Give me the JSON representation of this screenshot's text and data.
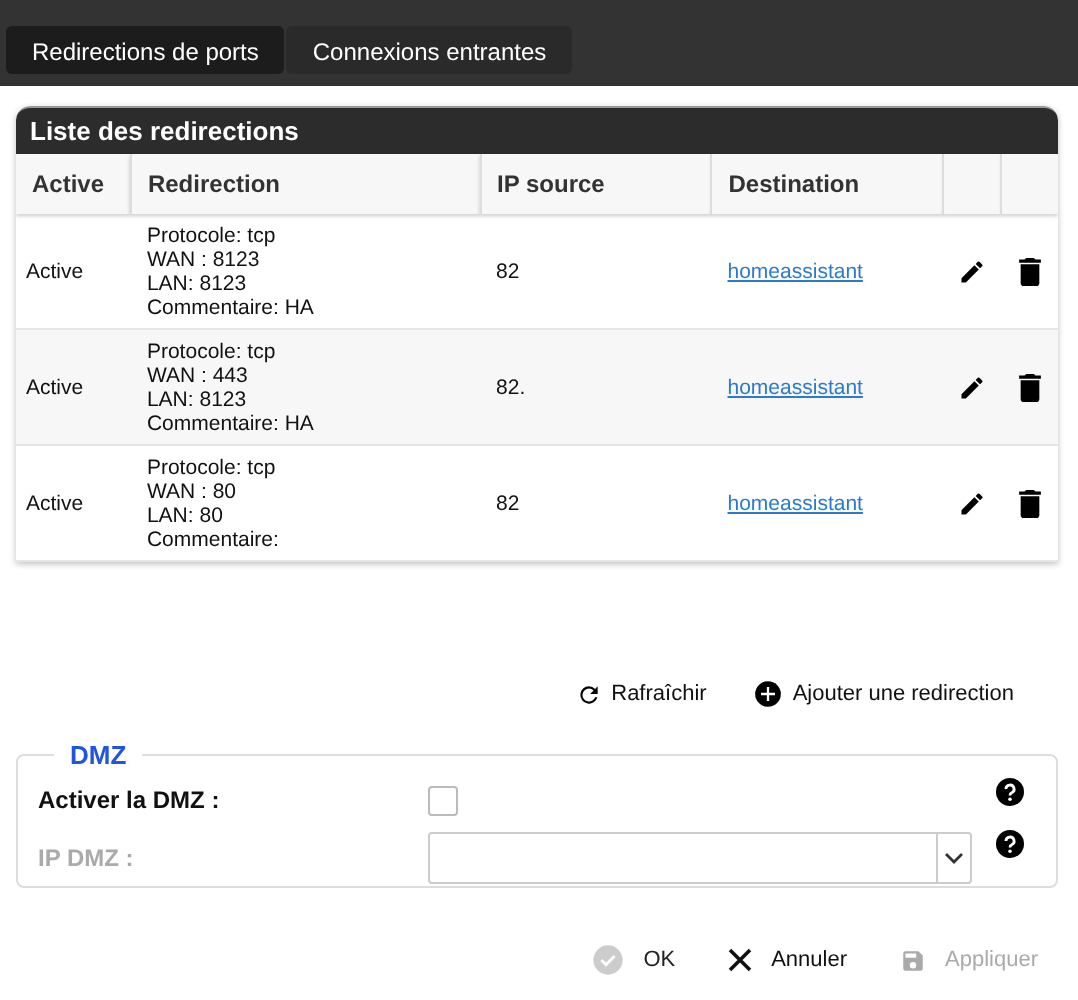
{
  "tabs": [
    {
      "label": "Redirections de ports",
      "selected": true
    },
    {
      "label": "Connexions entrantes",
      "selected": false
    }
  ],
  "panel": {
    "title": "Liste des redirections",
    "columns": [
      "Active",
      "Redirection",
      "IP source",
      "Destination"
    ],
    "rows": [
      {
        "active": "Active",
        "redirection": [
          "Protocole: tcp",
          "WAN : 8123",
          "LAN: 8123",
          "Commentaire: HA"
        ],
        "ip_source": "82",
        "destination": "homeassistant"
      },
      {
        "active": "Active",
        "redirection": [
          "Protocole: tcp",
          "WAN : 443",
          "LAN: 8123",
          "Commentaire: HA"
        ],
        "ip_source": "82.",
        "destination": "homeassistant"
      },
      {
        "active": "Active",
        "redirection": [
          "Protocole: tcp",
          "WAN : 80",
          "LAN: 80",
          "Commentaire:"
        ],
        "ip_source": "82",
        "destination": "homeassistant"
      }
    ]
  },
  "actions": [
    {
      "label": "Rafraîchir",
      "kind": "refresh"
    },
    {
      "label": "Ajouter une redirection",
      "kind": "add"
    }
  ],
  "dmz": {
    "title": "DMZ",
    "enable": {
      "label": "Activer la DMZ :",
      "checked": false
    },
    "ip": {
      "label": "IP DMZ :",
      "disabled": true
    }
  },
  "footer_buttons": [
    {
      "label": "OK",
      "kind": "ok",
      "disabled": true
    },
    {
      "label": "Annuler",
      "kind": "cancel",
      "disabled": false
    },
    {
      "label": "Appliquer",
      "kind": "save",
      "disabled": true
    }
  ]
}
